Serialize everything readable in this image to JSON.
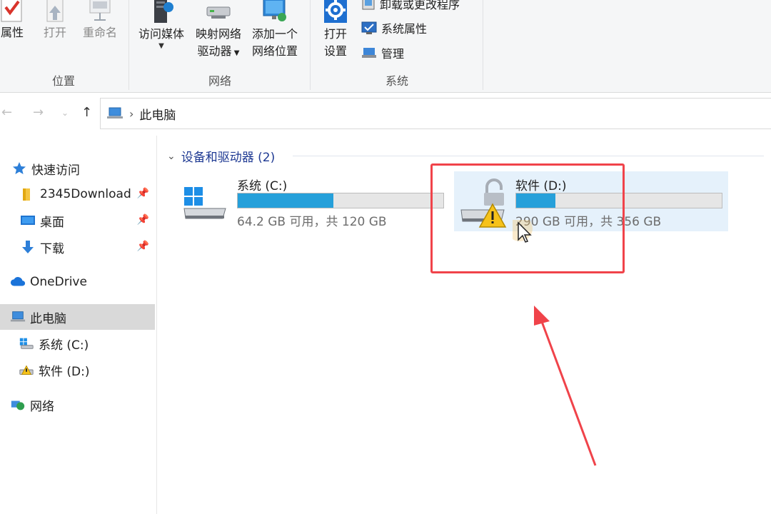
{
  "ribbon": {
    "location_group": {
      "label": "位置",
      "properties": "属性",
      "open": "打开",
      "rename": "重命名"
    },
    "network_group": {
      "label": "网络",
      "access_media": "访问媒体",
      "map_drive_line1": "映射网络",
      "map_drive_line2": "驱动器",
      "add_location_line1": "添加一个",
      "add_location_line2": "网络位置"
    },
    "system_group": {
      "label": "系统",
      "open_settings_line1": "打开",
      "open_settings_line2": "设置",
      "uninstall": "卸载或更改程序",
      "system_properties": "系统属性",
      "manage": "管理"
    }
  },
  "address": {
    "crumb": "此电脑"
  },
  "sidebar": {
    "quick_access": "快速访问",
    "items": [
      {
        "label": "2345Download",
        "icon": "folder-icon"
      },
      {
        "label": "桌面",
        "icon": "desktop-icon"
      },
      {
        "label": "下载",
        "icon": "download-icon"
      }
    ],
    "onedrive": "OneDrive",
    "this_pc": "此电脑",
    "drive_c": "系统 (C:)",
    "drive_d": "软件 (D:)",
    "network": "网络"
  },
  "content": {
    "group_title": "设备和驱动器 (2)",
    "drives": [
      {
        "name": "系统 (C:)",
        "info": "64.2 GB 可用，共 120 GB",
        "used_fraction": 0.465
      },
      {
        "name": "软件 (D:)",
        "info": "290 GB 可用，共 356 GB",
        "used_fraction": 0.19
      }
    ]
  },
  "colors": {
    "accent": "#26a0da",
    "annotation": "#f0434a",
    "selection": "#e5f1fb"
  }
}
